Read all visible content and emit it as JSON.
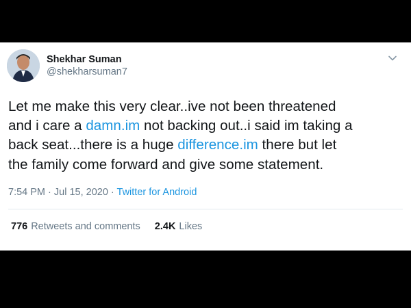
{
  "author": {
    "display_name": "Shekhar Suman",
    "handle": "@shekharsuman7"
  },
  "tweet": {
    "part1": "Let me make this very clear..ive not been threatened\nand i care a ",
    "link1": "damn.im",
    "part2": " not backing out..i said im taking a\nback seat...there is a huge ",
    "link2": "difference.im",
    "part3": " there but let\nthe family come forward and give some statement."
  },
  "meta": {
    "time": "7:54 PM",
    "separator": " · ",
    "date": "Jul 15, 2020",
    "separator2": " · ",
    "source": "Twitter for Android"
  },
  "stats": {
    "retweets_count": "776",
    "retweets_label": "Retweets and comments",
    "likes_count": "2.4K",
    "likes_label": "Likes"
  },
  "icons": {
    "menu": "chevron-down-icon",
    "avatar": "avatar"
  },
  "colors": {
    "link": "#1b95e0",
    "text": "#14171a",
    "secondary": "#657786",
    "background_band": "#000000"
  }
}
